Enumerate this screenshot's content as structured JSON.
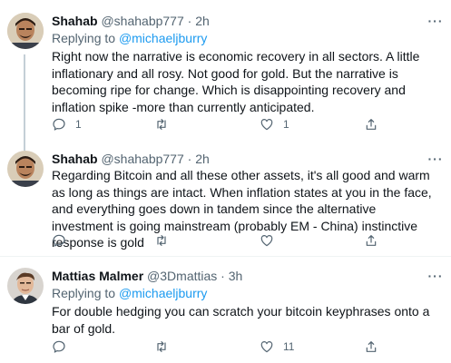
{
  "tweets": [
    {
      "name": "Shahab",
      "handle": "@shahabp777",
      "dot": "·",
      "time": "2h",
      "replying_prefix": "Replying to",
      "replying_to": "@michaeljburry",
      "text": "Right now the narrative is economic recovery in all sectors. A little inflationary and all rosy. Not good for gold. But the narrative is becoming ripe for change. Which is disappointing recovery and inflation spike -more than currently anticipated.",
      "replies": "1",
      "retweets": "",
      "likes": "1"
    },
    {
      "name": "Shahab",
      "handle": "@shahabp777",
      "dot": "·",
      "time": "2h",
      "text": "Regarding Bitcoin and all these other assets, it's all good and warm as long as things are intact. When inflation states at you in the face, and everything goes down in tandem since the alternative investment is going mainstream (probably EM - China) instinctive response is gold",
      "replies": "",
      "retweets": "",
      "likes": ""
    },
    {
      "name": "Mattias Malmer",
      "handle": "@3Dmattias",
      "dot": "·",
      "time": "3h",
      "replying_prefix": "Replying to",
      "replying_to": "@michaeljburry",
      "text": "For double hedging you can scratch your bitcoin keyphrases onto a bar of gold.",
      "replies": "",
      "retweets": "",
      "likes": "11"
    }
  ],
  "more_label": "···",
  "colors": {
    "accent": "#1d9bf0",
    "secondary_text": "#536471",
    "primary_text": "#0f1419",
    "thread_line": "#c4cfd6",
    "separator": "#eff3f4"
  },
  "icons": {
    "reply": "reply-icon",
    "retweet": "retweet-icon",
    "like": "heart-icon",
    "share": "share-icon",
    "more": "more-icon"
  }
}
